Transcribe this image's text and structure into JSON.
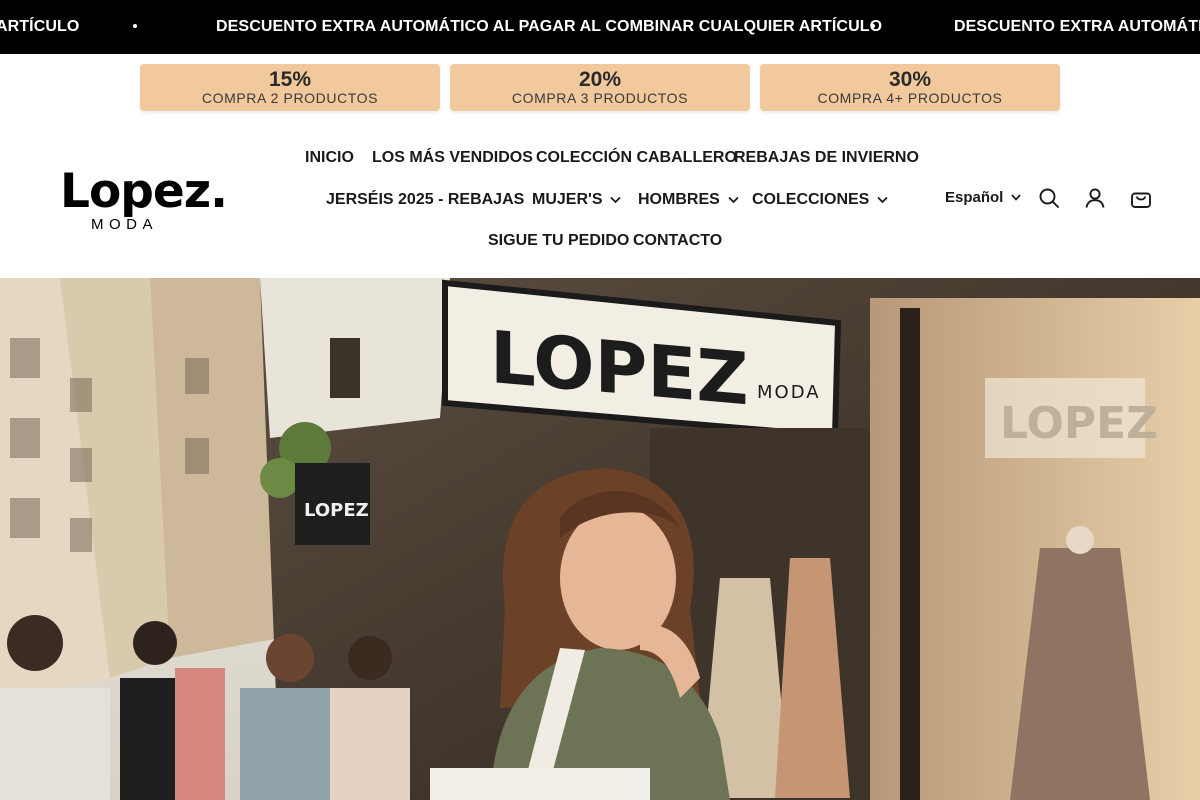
{
  "announcement": {
    "message": "DESCUENTO EXTRA AUTOMÁTICO AL PAGAR AL COMBINAR CUALQUIER ARTÍCULO",
    "left_fragment": "ARTÍCULO",
    "right_fragment": "DESCUENTO EXTRA AUTOMÁTICO A"
  },
  "tiers": [
    {
      "percent": "15%",
      "label": "COMPRA 2 PRODUCTOS"
    },
    {
      "percent": "20%",
      "label": "COMPRA 3 PRODUCTOS"
    },
    {
      "percent": "30%",
      "label": "COMPRA 4+ PRODUCTOS"
    }
  ],
  "logo": {
    "word": "Lopez.",
    "sub": "MODA"
  },
  "nav": {
    "row1": [
      "INICIO",
      "LOS MÁS VENDIDOS",
      "COLECCIÓN CABALLERO",
      "REBAJAS DE INVIERNO"
    ],
    "row2": [
      "JERSÉIS 2025 - REBAJAS",
      "MUJER'S",
      "HOMBRES",
      "COLECCIONES"
    ],
    "row3": [
      "SIGUE TU PEDIDO",
      "CONTACTO"
    ]
  },
  "language": {
    "selected": "Español"
  },
  "icons": [
    "search-icon",
    "account-icon",
    "cart-icon"
  ],
  "hero": {
    "store_sign": "LOPEZ",
    "store_sign_sub": "MODA",
    "side_sign": "LOPEZ",
    "window_sign": "LOPEZ"
  },
  "colors": {
    "announcement_bg": "#000000",
    "tier_bg": "#f1c99d"
  }
}
